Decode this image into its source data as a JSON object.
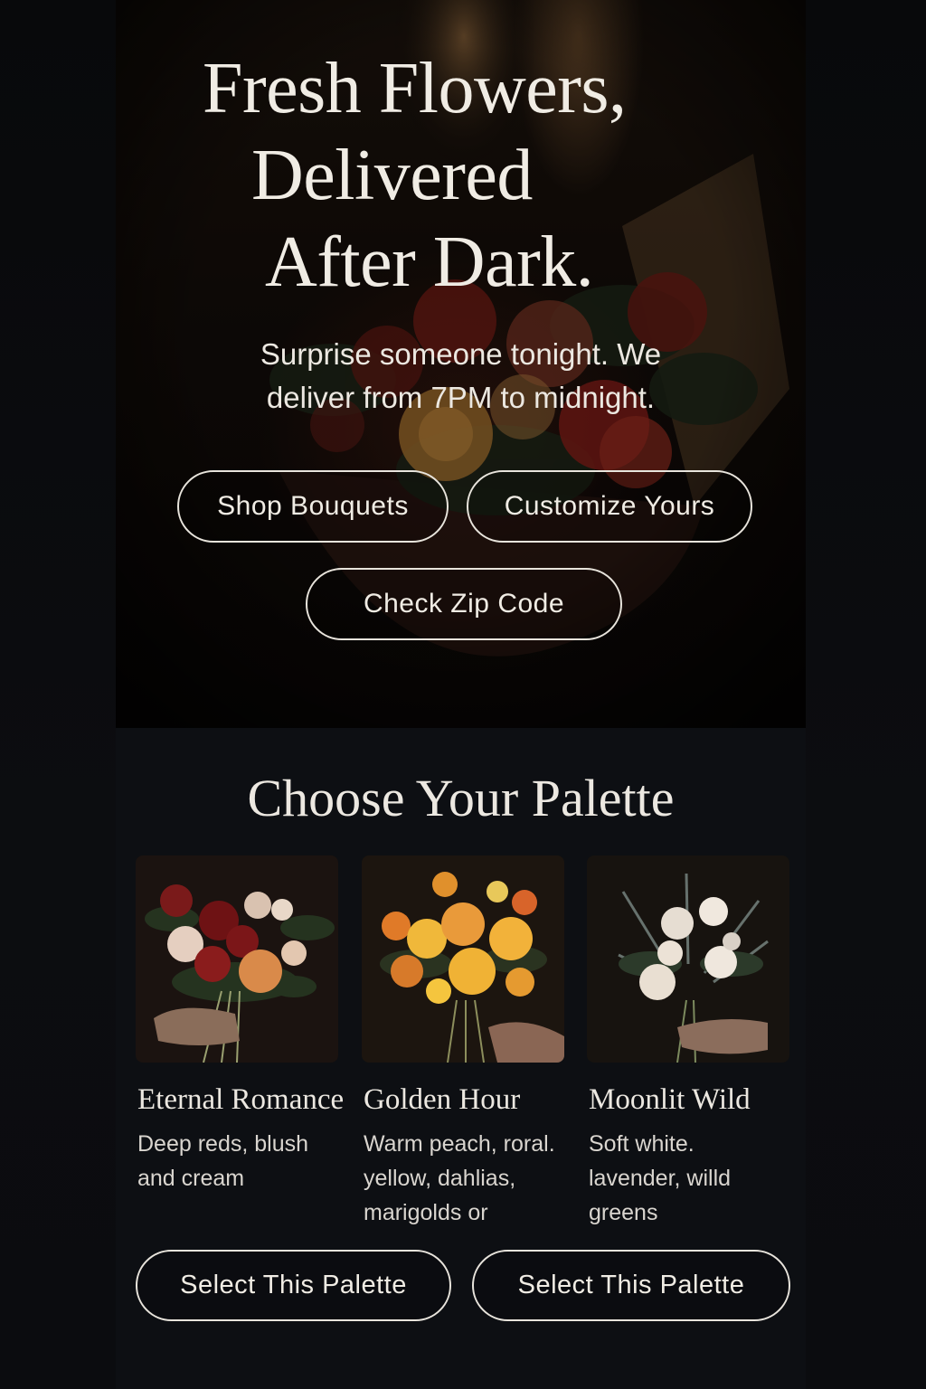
{
  "hero": {
    "title_line1": "Fresh Flowers,",
    "title_line2": "Delivered",
    "title_line3": "After Dark.",
    "subtitle_line1": "Surprise someone tonight. We",
    "subtitle_line2": "deliver from 7PM to midnight.",
    "buttons": {
      "shop": "Shop Bouquets",
      "customize": "Customize Yours",
      "zip": "Check Zip Code"
    }
  },
  "palette": {
    "title": "Choose Your Palette",
    "cards": [
      {
        "name": "Eternal Romance",
        "desc_lines": [
          "Deep reds, blush",
          "and cream"
        ],
        "image": "red-rose-bouquet"
      },
      {
        "name": "Golden Hour",
        "desc_lines": [
          "Warm peach, roral.",
          "yellow, dahlias,",
          "marigolds or"
        ],
        "image": "golden-bouquet"
      },
      {
        "name": "Moonlit Wild",
        "desc_lines": [
          "Soft white.",
          "lavender, willd",
          "greens"
        ],
        "image": "white-wild-bouquet"
      }
    ],
    "select_buttons": [
      "Select This Palette",
      "Select This Palette"
    ]
  },
  "colors": {
    "background": "#0d0f13",
    "text": "#ece8e1",
    "button_border": "#e8e4dc"
  }
}
